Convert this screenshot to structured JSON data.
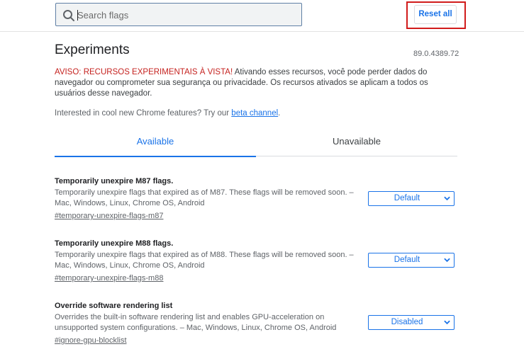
{
  "header": {
    "search": {
      "placeholder": "Search flags",
      "value": ""
    },
    "reset_label": "Reset all"
  },
  "main": {
    "title": "Experiments",
    "version": "89.0.4389.72",
    "warning_strong": "AVISO: RECURSOS EXPERIMENTAIS À VISTA!",
    "warning_text": " Ativando esses recursos, você pode perder dados do navegador ou comprometer sua segurança ou privacidade. Os recursos ativados se aplicam a todos os usuários desse navegador.",
    "promo_text": "Interested in cool new Chrome features? Try our ",
    "promo_link": "beta channel",
    "promo_end": ".",
    "tabs": [
      {
        "label": "Available",
        "active": true
      },
      {
        "label": "Unavailable",
        "active": false
      }
    ],
    "flags": [
      {
        "name": "Temporarily unexpire M87 flags.",
        "description": "Temporarily unexpire flags that expired as of M87. These flags will be removed soon. – Mac, Windows, Linux, Chrome OS, Android",
        "link": "#temporary-unexpire-flags-m87",
        "value": "Default"
      },
      {
        "name": "Temporarily unexpire M88 flags.",
        "description": "Temporarily unexpire flags that expired as of M88. These flags will be removed soon. – Mac, Windows, Linux, Chrome OS, Android",
        "link": "#temporary-unexpire-flags-m88",
        "value": "Default"
      },
      {
        "name": "Override software rendering list",
        "description": "Overrides the built-in software rendering list and enables GPU-acceleration on unsupported system configurations. – Mac, Windows, Linux, Chrome OS, Android",
        "link": "#ignore-gpu-blocklist",
        "value": "Disabled"
      }
    ]
  },
  "colors": {
    "accent": "#1a73e8",
    "warning": "#c5221f",
    "highlight": "#d11b1b"
  },
  "icons": {
    "search": "search-icon",
    "select": "chevron-down-icon"
  }
}
